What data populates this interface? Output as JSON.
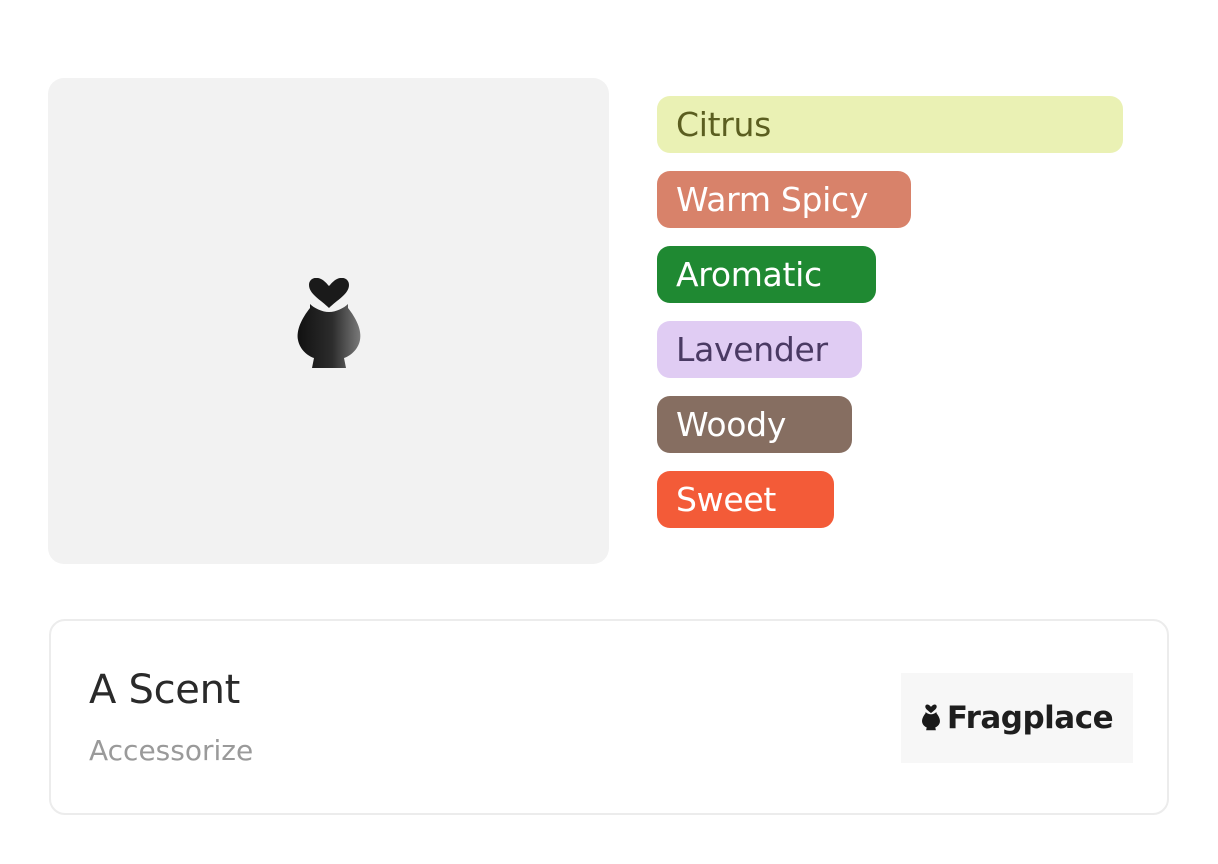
{
  "product": {
    "name": "A Scent",
    "brand": "Accessorize"
  },
  "image": {
    "icon": "perfume-bottle-heart-icon"
  },
  "accords": [
    {
      "label": "Citrus",
      "level": 0.97,
      "bg": "#eaf1b4",
      "fg": "#5b5e20"
    },
    {
      "label": "Warm Spicy",
      "level": 0.53,
      "bg": "#d8826a",
      "fg": "#ffffff"
    },
    {
      "label": "Aromatic",
      "level": 0.456,
      "bg": "#1f8932",
      "fg": "#ffffff"
    },
    {
      "label": "Lavender",
      "level": 0.427,
      "bg": "#e0ccf3",
      "fg": "#4a3a63"
    },
    {
      "label": "Woody",
      "level": 0.406,
      "bg": "#866e61",
      "fg": "#ffffff"
    },
    {
      "label": "Sweet",
      "level": 0.369,
      "bg": "#f35b38",
      "fg": "#ffffff"
    }
  ],
  "store": {
    "name": "Fragplace",
    "icon": "perfume-bottle-heart-icon"
  }
}
